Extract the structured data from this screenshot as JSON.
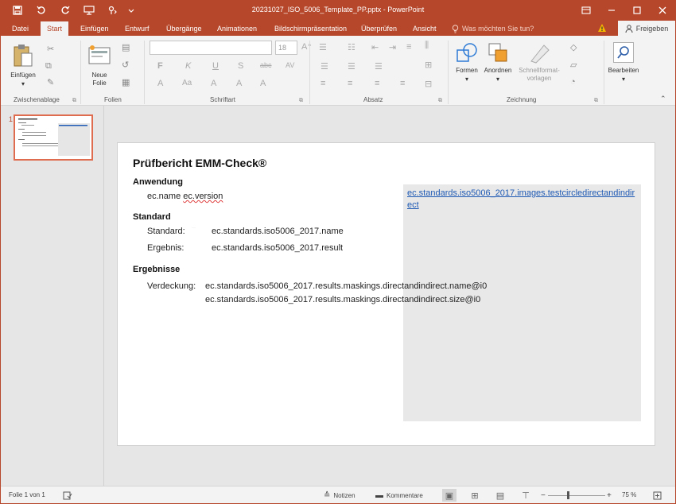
{
  "titlebar": {
    "title": "20231027_ISO_5006_Template_PP.pptx - PowerPoint",
    "qat": [
      "save-icon",
      "undo-icon",
      "redo-icon",
      "presenter-icon",
      "touch-mode-icon",
      "customize-icon"
    ]
  },
  "tabs": [
    {
      "label": "Datei"
    },
    {
      "label": "Start"
    },
    {
      "label": "Einfügen"
    },
    {
      "label": "Entwurf"
    },
    {
      "label": "Übergänge"
    },
    {
      "label": "Animationen"
    },
    {
      "label": "Bildschirmpräsentation"
    },
    {
      "label": "Überprüfen"
    },
    {
      "label": "Ansicht"
    }
  ],
  "tellme": "Was möchten Sie tun?",
  "share_label": "Freigeben",
  "ribbon": {
    "clipboard": {
      "paste_label": "Einfügen",
      "group_label": "Zwischenablage"
    },
    "slides": {
      "new_slide_label": "Neue Folie",
      "group_label": "Folien"
    },
    "font": {
      "font_name": "",
      "font_size": "18",
      "group_label": "Schriftart",
      "bold": "F",
      "italic": "K",
      "underline": "U",
      "shadow": "S",
      "strike": "abc",
      "spacing": "AV"
    },
    "paragraph": {
      "group_label": "Absatz"
    },
    "drawing": {
      "shapes_label": "Formen",
      "arrange_label": "Anordnen",
      "quickstyles_label": "Schnellformat-vorlagen",
      "group_label": "Zeichnung"
    },
    "editing": {
      "edit_label": "Bearbeiten"
    }
  },
  "slide": {
    "number": "1",
    "title": "Prüfbericht EMM-Check®",
    "sec_app": "Anwendung",
    "app_name": "ec.name",
    "app_version": "ec.version",
    "sec_standard": "Standard",
    "std_label": "Standard:",
    "std_value": "ec.standards.iso5006_2017.name",
    "result_label": "Ergebnis:",
    "result_value": "ec.standards.iso5006_2017.result",
    "sec_results": "Ergebnisse",
    "masking_label": "Verdeckung:",
    "masking_name": "ec.standards.iso5006_2017.results.maskings.directandindirect.name@i0",
    "masking_size": "ec.standards.iso5006_2017.results.maskings.directandindirect.size@i0",
    "image_link": "ec.standards.iso5006_2017.images.testcircledirectandindirect"
  },
  "status": {
    "slide_info": "Folie 1 von 1",
    "notes": "Notizen",
    "comments": "Kommentare",
    "zoom": "75 %"
  },
  "colors": {
    "accent": "#b7472a",
    "link": "#1f5ab4"
  }
}
